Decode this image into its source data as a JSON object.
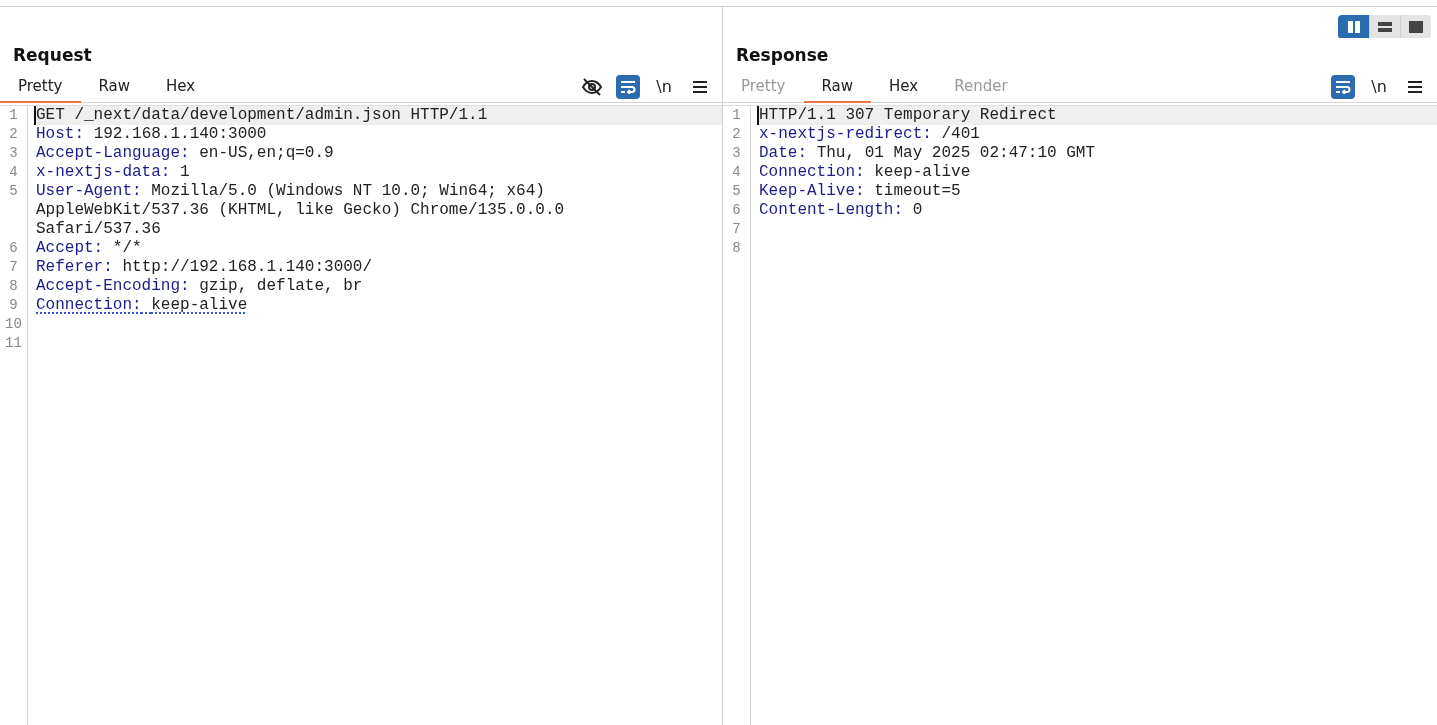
{
  "view_toggle": [
    {
      "kind": "columns",
      "selected": true
    },
    {
      "kind": "rows",
      "selected": false
    },
    {
      "kind": "single",
      "selected": false
    }
  ],
  "request": {
    "title": "Request",
    "tabs": [
      {
        "label": "Pretty",
        "selected": true,
        "disabled": false
      },
      {
        "label": "Raw",
        "selected": false,
        "disabled": false
      },
      {
        "label": "Hex",
        "selected": false,
        "disabled": false
      }
    ],
    "toolbar": [
      {
        "kind": "hide",
        "selected": false
      },
      {
        "kind": "wrap",
        "selected": true
      },
      {
        "kind": "newline",
        "label": "\\n",
        "selected": false
      },
      {
        "kind": "menu",
        "selected": false
      }
    ],
    "lines": [
      {
        "number": "1",
        "value": "GET /_next/data/development/admin.json HTTP/1.1",
        "current": true
      },
      {
        "number": "2",
        "name": "Host:",
        "value": "192.168.1.140:3000"
      },
      {
        "number": "3",
        "name": "Accept-Language:",
        "value": "en-US,en;q=0.9"
      },
      {
        "number": "4",
        "name": "x-nextjs-data:",
        "value": "1"
      },
      {
        "number": "5",
        "name": "User-Agent:",
        "value": "Mozilla/5.0 (Windows NT 10.0; Win64; x64)",
        "continuation": [
          "AppleWebKit/537.36 (KHTML, like Gecko) Chrome/135.0.0.0",
          "Safari/537.36"
        ]
      },
      {
        "number": "6",
        "name": "Accept:",
        "value": "*/*"
      },
      {
        "number": "7",
        "name": "Referer:",
        "value": "http://192.168.1.140:3000/"
      },
      {
        "number": "8",
        "name": "Accept-Encoding:",
        "value": "gzip, deflate, br"
      },
      {
        "number": "9",
        "name": "Connection:",
        "value": "keep-alive",
        "flagged": true
      },
      {
        "number": "10"
      },
      {
        "number": "11"
      }
    ]
  },
  "response": {
    "title": "Response",
    "tabs": [
      {
        "label": "Pretty",
        "selected": false,
        "disabled": true
      },
      {
        "label": "Raw",
        "selected": true,
        "disabled": false
      },
      {
        "label": "Hex",
        "selected": false,
        "disabled": false
      },
      {
        "label": "Render",
        "selected": false,
        "disabled": true
      }
    ],
    "toolbar": [
      {
        "kind": "wrap",
        "selected": true
      },
      {
        "kind": "newline",
        "label": "\\n",
        "selected": false
      },
      {
        "kind": "menu",
        "selected": false
      }
    ],
    "lines": [
      {
        "number": "1",
        "value": "HTTP/1.1 307 Temporary Redirect",
        "current": true
      },
      {
        "number": "2",
        "name": "x-nextjs-redirect:",
        "value": "/401"
      },
      {
        "number": "3",
        "name": "Date:",
        "value": "Thu, 01 May 2025 02:47:10 GMT"
      },
      {
        "number": "4",
        "name": "Connection:",
        "value": "keep-alive"
      },
      {
        "number": "5",
        "name": "Keep-Alive:",
        "value": "timeout=5"
      },
      {
        "number": "6",
        "name": "Content-Length:",
        "value": "0"
      },
      {
        "number": "7"
      },
      {
        "number": "8"
      }
    ]
  }
}
